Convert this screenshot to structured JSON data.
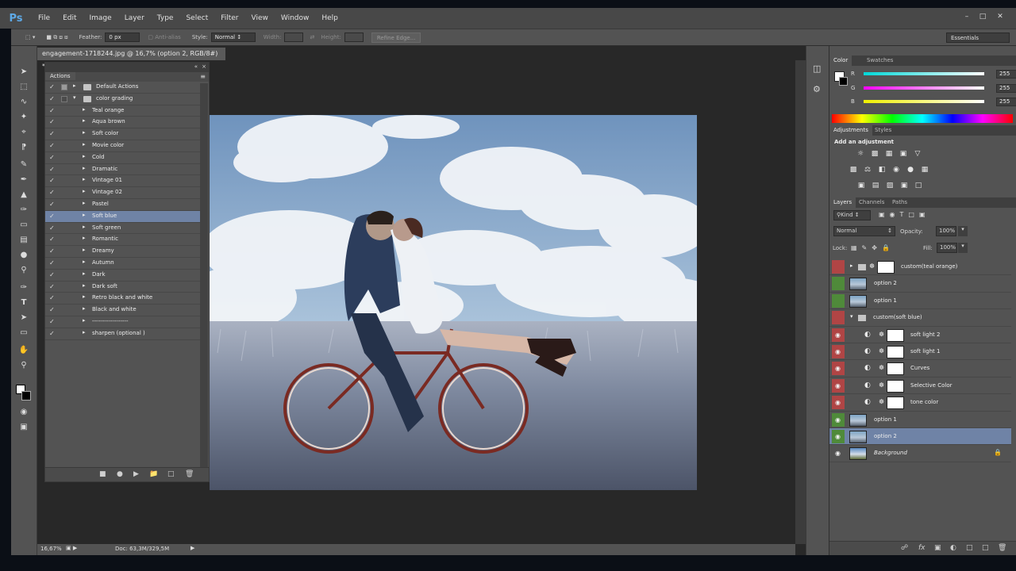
{
  "app": {
    "logo": "Ps"
  },
  "menu": [
    "File",
    "Edit",
    "Image",
    "Layer",
    "Type",
    "Select",
    "Filter",
    "View",
    "Window",
    "Help"
  ],
  "options_bar": {
    "feather_label": "Feather:",
    "feather_value": "0 px",
    "antialias_label": "Anti-alias",
    "style_label": "Style:",
    "style_value": "Normal",
    "width_label": "Width:",
    "height_label": "Height:",
    "refine_edge": "Refine Edge...",
    "workspace": "Essentials"
  },
  "document": {
    "tab_title": "engagement-1718244.jpg @ 16,7% (option 2, RGB/8#) *",
    "zoom": "16,67%",
    "doc_info": "Doc: 63,3M/329,5M"
  },
  "actions_panel": {
    "tab": "Actions",
    "items": [
      {
        "label": "Default Actions",
        "kind": "set",
        "expanded": false
      },
      {
        "label": "color grading",
        "kind": "set",
        "expanded": true
      },
      {
        "label": "Teal orange",
        "kind": "action"
      },
      {
        "label": "Aqua brown",
        "kind": "action"
      },
      {
        "label": "Soft color",
        "kind": "action"
      },
      {
        "label": "Movie color",
        "kind": "action"
      },
      {
        "label": "Cold",
        "kind": "action"
      },
      {
        "label": "Dramatic",
        "kind": "action"
      },
      {
        "label": "Vintage 01",
        "kind": "action"
      },
      {
        "label": "Vintage 02",
        "kind": "action"
      },
      {
        "label": "Pastel",
        "kind": "action"
      },
      {
        "label": "Soft blue",
        "kind": "action",
        "selected": true
      },
      {
        "label": "Soft green",
        "kind": "action"
      },
      {
        "label": "Romantic",
        "kind": "action"
      },
      {
        "label": " Dreamy",
        "kind": "action"
      },
      {
        "label": "Autumn",
        "kind": "action"
      },
      {
        "label": "Dark",
        "kind": "action"
      },
      {
        "label": "Dark soft",
        "kind": "action"
      },
      {
        "label": "Retro black and white",
        "kind": "action"
      },
      {
        "label": "Black and white",
        "kind": "action"
      },
      {
        "label": "------------------",
        "kind": "action"
      },
      {
        "label": "sharpen (optional )",
        "kind": "action"
      }
    ]
  },
  "color_panel": {
    "tabs": [
      "Color",
      "Swatches"
    ],
    "channels": [
      {
        "name": "R",
        "value": "255",
        "gradient": "#00d8d8,#ffffff"
      },
      {
        "name": "G",
        "value": "255",
        "gradient": "#ff00ff,#ffffff"
      },
      {
        "name": "B",
        "value": "255",
        "gradient": "#f0f000,#ffffff"
      }
    ]
  },
  "adjustments_panel": {
    "tabs": [
      "Adjustments",
      "Styles"
    ],
    "title": "Add an adjustment"
  },
  "layers_panel": {
    "tabs": [
      "Layers",
      "Channels",
      "Paths"
    ],
    "filter": "Kind",
    "blend_mode": "Normal",
    "opacity_label": "Opacity:",
    "opacity": "100%",
    "lock_label": "Lock:",
    "fill_label": "Fill:",
    "fill": "100%",
    "layers": [
      {
        "name": "custom(teal orange)",
        "type": "group-collapsed",
        "tag": "red",
        "visible": false
      },
      {
        "name": "option 2",
        "type": "layer",
        "tag": "green",
        "visible": false
      },
      {
        "name": "option 1",
        "type": "layer",
        "tag": "green",
        "visible": false
      },
      {
        "name": "custom(soft blue)",
        "type": "group-expanded",
        "tag": "red",
        "visible": false
      },
      {
        "name": "soft light 2",
        "type": "adjustment",
        "tag": "red",
        "visible": true
      },
      {
        "name": "soft light 1",
        "type": "adjustment",
        "tag": "red",
        "visible": true
      },
      {
        "name": "Curves",
        "type": "adjustment",
        "tag": "red",
        "visible": true
      },
      {
        "name": "Selective Color",
        "type": "adjustment",
        "tag": "red",
        "visible": true
      },
      {
        "name": "tone color",
        "type": "adjustment",
        "tag": "red",
        "visible": true
      },
      {
        "name": "option 1",
        "type": "layer",
        "tag": "green",
        "visible": true
      },
      {
        "name": "option 2",
        "type": "layer",
        "tag": "green",
        "visible": true,
        "selected": true
      },
      {
        "name": "Background",
        "type": "background",
        "tag": "none",
        "visible": true
      }
    ]
  },
  "colors": {
    "tag_red": "#b04545",
    "tag_green": "#4f8a3a",
    "selection": "#6f83a6",
    "panel": "#535353"
  }
}
